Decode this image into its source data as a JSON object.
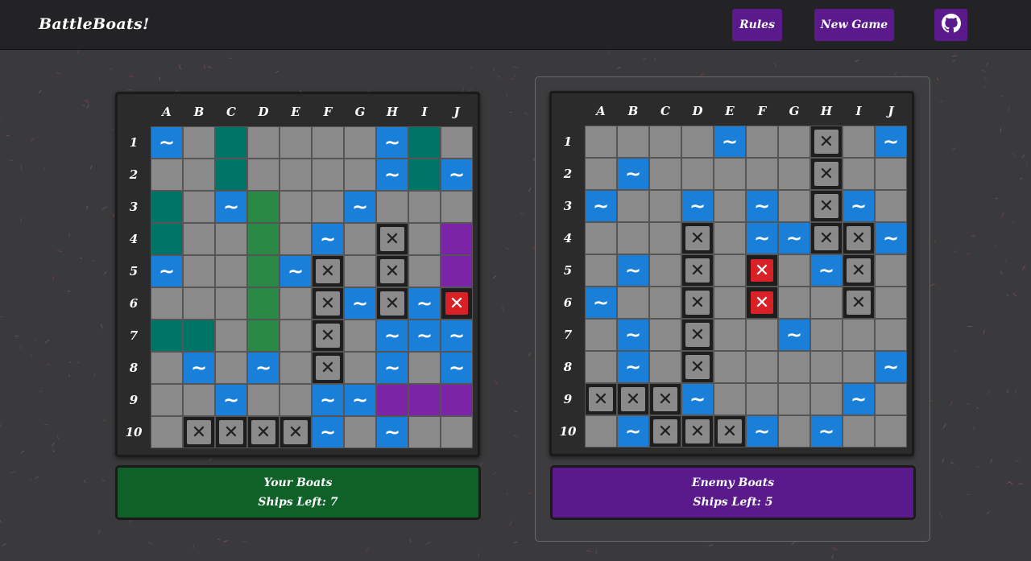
{
  "app": {
    "title": "BattleBoats!"
  },
  "nav": {
    "rules_label": "Rules",
    "new_game_label": "New Game",
    "github_icon": "github-icon"
  },
  "columns": [
    "A",
    "B",
    "C",
    "D",
    "E",
    "F",
    "G",
    "H",
    "I",
    "J"
  ],
  "rows": [
    "1",
    "2",
    "3",
    "4",
    "5",
    "6",
    "7",
    "8",
    "9",
    "10"
  ],
  "legend": {
    "W": "water",
    "X": "miss",
    "H": "hit",
    ".": "empty",
    "T": "ship-teal",
    "G": "ship-green",
    "P": "ship-purple"
  },
  "colors": {
    "teal": "#007466",
    "green": "#2a8a45",
    "purple": "#7c24a8",
    "water": "#1a7fd8",
    "empty": "#8a8a8a",
    "hit": "#d92027",
    "player_panel": "#0f6128",
    "enemy_panel": "#5a1a8c"
  },
  "player_board": {
    "grid": [
      "W.T....WT.",
      "..T....WTW",
      "T.WG..W...",
      "T..G.W.X.P",
      "W..GWX.X.P",
      "...G.XWXWH",
      "TT.G.X.WWW",
      ".W.W.X.W.W",
      "..W..WWPPP",
      ".XXXXW.W.."
    ]
  },
  "enemy_board": {
    "grid": [
      "....W..X.W",
      ".W.....X..",
      "W..W.W.XW.",
      "...X.WWXXW",
      ".W.X.H.WX.",
      "W..X.H..X.",
      ".W.X..W...",
      ".W.X.....W",
      "XXXW....W.",
      ".WXXXW.W.."
    ]
  },
  "player_status": {
    "title": "Your Boats",
    "ships_left": "Ships Left: 7"
  },
  "enemy_status": {
    "title": "Enemy Boats",
    "ships_left": "Ships Left: 5"
  }
}
